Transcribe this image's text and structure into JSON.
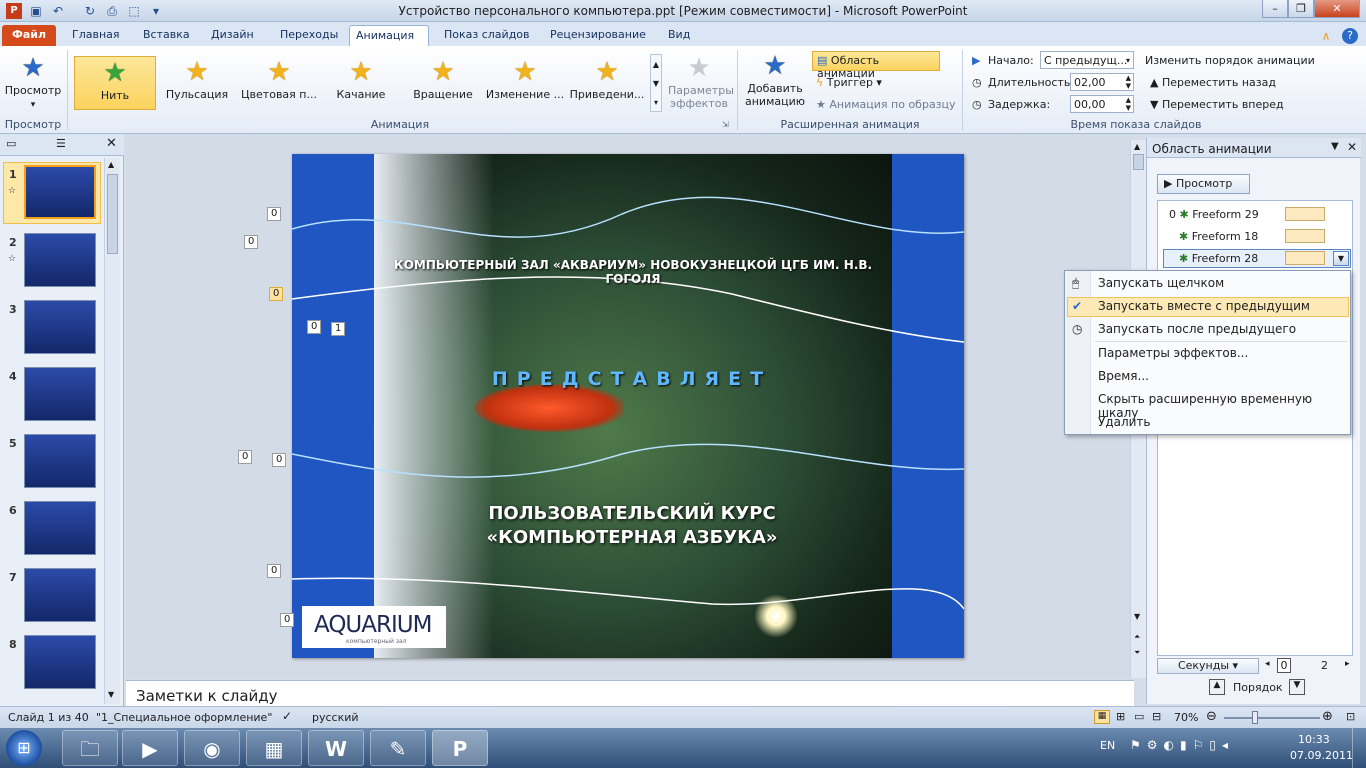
{
  "window": {
    "title": "Устройство персонального компьютера.ppt [Режим совместимости] - Microsoft PowerPoint"
  },
  "tabs": [
    "Файл",
    "Главная",
    "Вставка",
    "Дизайн",
    "Переходы",
    "Анимация",
    "Показ слайдов",
    "Рецензирование",
    "Вид"
  ],
  "ribbon": {
    "preview_label": "Просмотр",
    "preview_group": "Просмотр",
    "animations": [
      "Нить",
      "Пульсация",
      "Цветовая п...",
      "Качание",
      "Вращение",
      "Изменение ...",
      "Приведени..."
    ],
    "animation_group": "Анимация",
    "effect_params": "Параметры эффектов",
    "add_animation": "Добавить анимацию",
    "anim_pane_btn": "Область анимации",
    "trigger": "Триггер",
    "anim_painter": "Анимация по образцу",
    "advanced_group": "Расширенная анимация",
    "start_label": "Начало:",
    "start_value": "С предыдущ...",
    "duration_label": "Длительность:",
    "duration_value": "02,00",
    "delay_label": "Задержка:",
    "delay_value": "00,00",
    "reorder_label": "Изменить порядок анимации",
    "move_earlier": "Переместить назад",
    "move_later": "Переместить вперед",
    "timing_group": "Время показа слайдов"
  },
  "thumbs": {
    "numbers": [
      "1",
      "2",
      "3",
      "4",
      "5",
      "6",
      "7",
      "8"
    ]
  },
  "slide": {
    "header": "КОМПЬЮТЕРНЫЙ ЗАЛ «АКВАРИУМ» НОВОКУЗНЕЦКОЙ ЦГБ ИМ. Н.В. ГОГОЛЯ",
    "presents": "ПРЕДСТАВЛЯЕТ",
    "course_line1": "ПОЛЬЗОВАТЕЛЬСКИЙ  КУРС",
    "course_line2": "«КОМПЬЮТЕРНАЯ  АЗБУКА»",
    "logo": "AQUARIUM",
    "logo_sub": "компьютерный зал",
    "tags": [
      "0",
      "0",
      "0",
      "0",
      "1",
      "0",
      "0",
      "0",
      "0"
    ]
  },
  "notes": {
    "placeholder": "Заметки к слайду"
  },
  "anim_pane": {
    "title": "Область анимации",
    "play": "Просмотр",
    "items": [
      {
        "index": "0",
        "name": "Freeform 29"
      },
      {
        "index": "",
        "name": "Freeform 18"
      },
      {
        "index": "",
        "name": "Freeform 28"
      }
    ],
    "seconds": "Секунды",
    "scale0": "0",
    "scale2": "2",
    "reorder": "Порядок"
  },
  "context_menu": [
    "Запускать щелчком",
    "Запускать вместе с предыдущим",
    "Запускать после предыдущего",
    "Параметры эффектов...",
    "Время...",
    "Скрыть расширенную временную шкалу",
    "Удалить"
  ],
  "status": {
    "slide_of": "Слайд 1 из 40",
    "theme": "\"1_Специальное оформление\"",
    "language": "русский",
    "zoom": "70%"
  },
  "taskbar": {
    "lang": "EN",
    "time": "10:33",
    "date": "07.09.2011"
  },
  "colors": {
    "accent": "#d44a1b",
    "slide_blue": "#1f56c2",
    "selection": "#fbd35e"
  }
}
